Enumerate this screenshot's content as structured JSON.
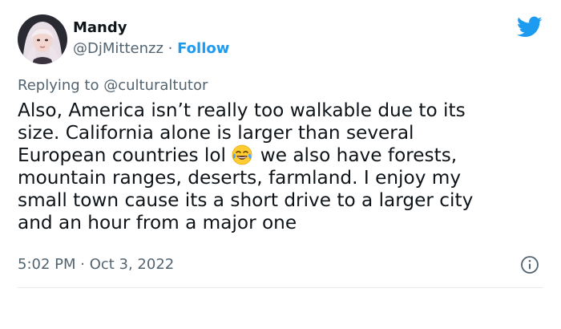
{
  "tweet": {
    "author": {
      "name": "Mandy",
      "handle": "@DjMittenzz",
      "separator": "·",
      "follow_label": "Follow"
    },
    "reply": {
      "prefix": "Replying to",
      "user": "@culturaltutor"
    },
    "body_lines": {
      "line1": "Also, America isn’t really too walkable due to its",
      "line2": "size. California alone is larger than several",
      "line3_before_emoji": "European countries lol",
      "line3_after_emoji": "we also have forests,",
      "line4": "mountain ranges, deserts,  farmland. I enjoy my",
      "line5": "small town cause its a short drive to a larger city",
      "line6": "and an hour from a major one"
    },
    "emoji": "face-with-tears-of-joy-icon",
    "timestamp": "5:02 PM · Oct 3, 2022",
    "icons": {
      "brand": "twitter-bird-icon",
      "info": "info-icon"
    },
    "colors": {
      "accent": "#1d9bf0",
      "muted": "#536471",
      "text": "#0f1419"
    }
  }
}
